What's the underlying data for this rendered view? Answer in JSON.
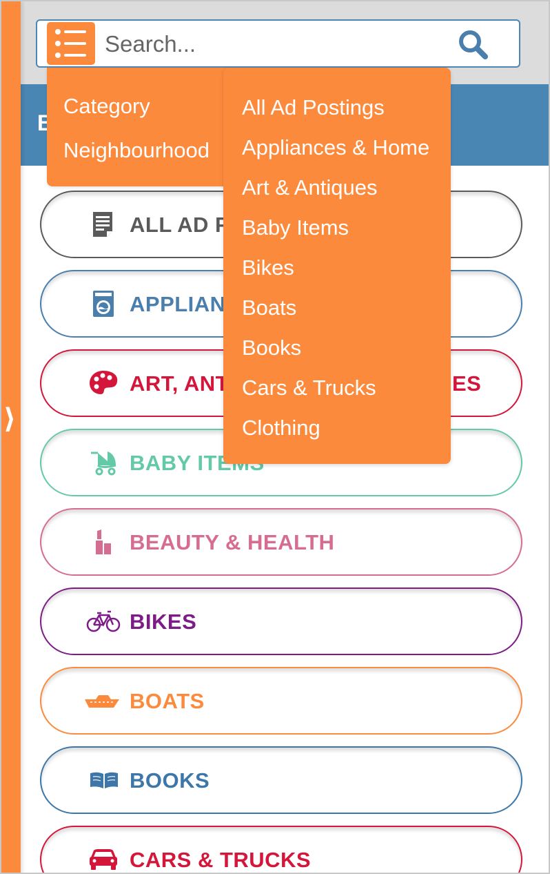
{
  "search": {
    "placeholder": "Search..."
  },
  "header": {
    "band_text": "B"
  },
  "dropdown": {
    "filters": [
      "Category",
      "Neighbourhood"
    ],
    "categories": [
      "All Ad Postings",
      "Appliances & Home",
      "Art & Antiques",
      "Baby Items",
      "Bikes",
      "Boats",
      "Books",
      "Cars & Trucks",
      "Clothing"
    ]
  },
  "category_buttons": [
    {
      "label": "ALL AD P",
      "color": "#5a5a5a",
      "icon": "document-icon"
    },
    {
      "label": "APPLIAN",
      "color": "#4a7ead",
      "icon": "washing-machine-icon"
    },
    {
      "label": "ART, ANT",
      "label_tail": "ES",
      "color": "#d4163a",
      "icon": "palette-icon"
    },
    {
      "label": "BABY ITEMS",
      "color": "#63c9a6",
      "icon": "stroller-icon"
    },
    {
      "label": "BEAUTY & HEALTH",
      "color": "#d76c93",
      "icon": "lipstick-icon"
    },
    {
      "label": "BIKES",
      "color": "#7d1c87",
      "icon": "bicycle-icon"
    },
    {
      "label": "BOATS",
      "color": "#fc8a3c",
      "icon": "boat-icon"
    },
    {
      "label": "BOOKS",
      "color": "#3d76a8",
      "icon": "book-icon"
    },
    {
      "label": "CARS & TRUCKS",
      "color": "#d4163a",
      "icon": "car-icon"
    }
  ],
  "colors": {
    "accent": "#fc8a3c",
    "band": "#4a86b4",
    "topbar": "#dcdcdc"
  }
}
